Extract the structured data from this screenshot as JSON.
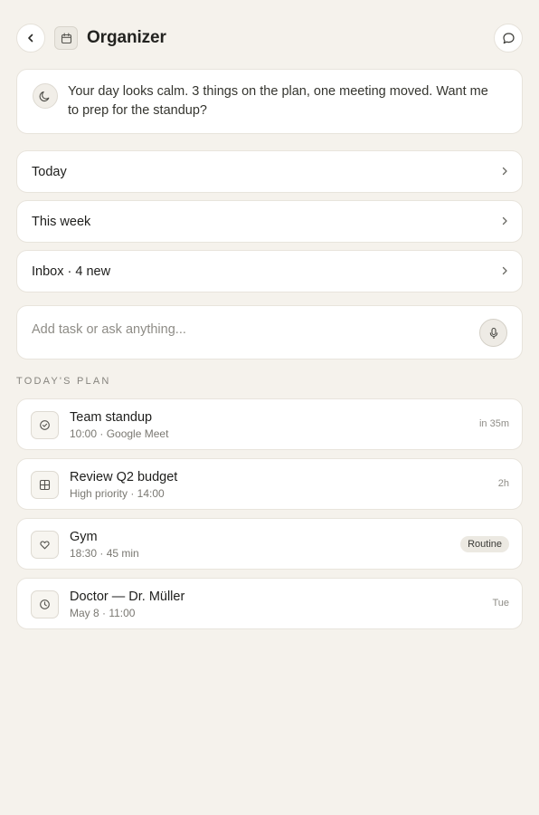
{
  "header": {
    "title": "Organizer",
    "back_icon": "chevron-left-icon",
    "app_icon": "calendar-icon",
    "chat_icon": "chat-bubble-icon"
  },
  "summary": {
    "icon": "moon-icon",
    "message": "Your day looks calm. 3 things on the plan, one meeting moved. Want me to prep for the standup?"
  },
  "nav": [
    {
      "label": "Today"
    },
    {
      "label": "This week"
    },
    {
      "label": "Inbox · 4 new"
    }
  ],
  "input": {
    "placeholder": "Add task or ask anything...",
    "value": "",
    "mic_icon": "microphone-icon"
  },
  "plan": {
    "section_label": "TODAY'S PLAN",
    "items": [
      {
        "title": "Team standup",
        "subtitle": "10:00 · Google Meet",
        "meta": "in 35m",
        "icon": "check-circle-icon"
      },
      {
        "title": "Review Q2 budget",
        "subtitle": "High priority · 14:00",
        "meta": "2h",
        "icon": "grid-icon"
      },
      {
        "title": "Gym",
        "subtitle": "18:30 · 45 min",
        "badge": "Routine",
        "icon": "heart-icon"
      },
      {
        "title": "Doctor — Dr. Müller",
        "subtitle": "May 8 · 11:00",
        "meta": "Tue",
        "icon": "clock-icon"
      }
    ]
  },
  "colors": {
    "background": "#f5f2ec",
    "card": "#ffffff",
    "border": "#e8e4dc",
    "text": "#1e1e1c",
    "muted": "#8e8c86"
  }
}
